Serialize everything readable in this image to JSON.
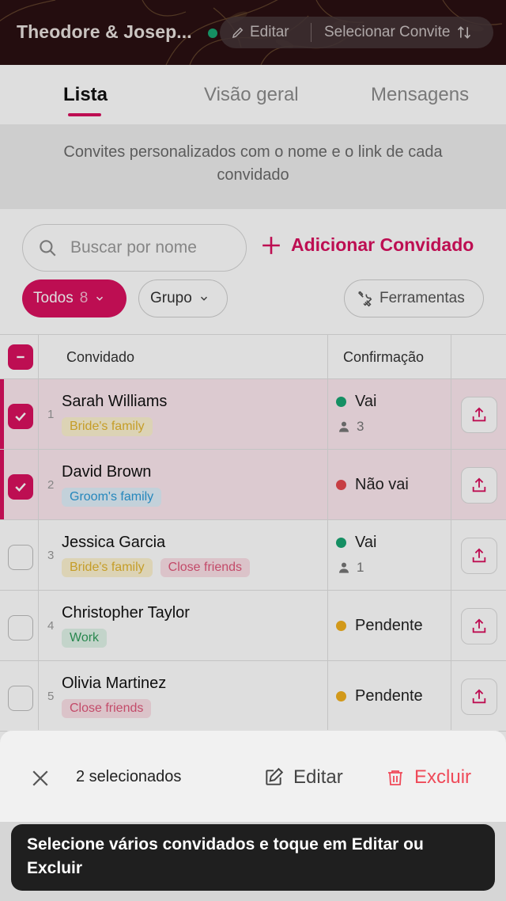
{
  "header": {
    "title": "Theodore & Josep...",
    "edit_label": "Editar",
    "select_label": "Selecionar Convite"
  },
  "tabs": [
    {
      "label": "Lista",
      "active": true
    },
    {
      "label": "Visão geral",
      "active": false
    },
    {
      "label": "Mensagens",
      "active": false
    }
  ],
  "banner": "Convites personalizados com o nome e o link de cada convidado",
  "search": {
    "placeholder": "Buscar por nome"
  },
  "add_guest_label": "Adicionar Convidado",
  "filters": {
    "todos_label": "Todos",
    "todos_count": "8",
    "grupo_label": "Grupo",
    "tools_label": "Ferramentas"
  },
  "table": {
    "headers": {
      "guest": "Convidado",
      "confirmation": "Confirmação"
    },
    "rows": [
      {
        "index": "1",
        "name": "Sarah Williams",
        "tags": [
          "Bride's family"
        ],
        "status": "Vai",
        "status_color": "#19a572",
        "people": "3",
        "selected": true
      },
      {
        "index": "2",
        "name": "David Brown",
        "tags": [
          "Groom's family"
        ],
        "status": "Não vai",
        "status_color": "#e5484d",
        "people": "",
        "selected": true
      },
      {
        "index": "3",
        "name": "Jessica Garcia",
        "tags": [
          "Bride's family",
          "Close friends"
        ],
        "status": "Vai",
        "status_color": "#19a572",
        "people": "1",
        "selected": false
      },
      {
        "index": "4",
        "name": "Christopher Taylor",
        "tags": [
          "Work"
        ],
        "status": "Pendente",
        "status_color": "#f2b01e",
        "people": "",
        "selected": false
      },
      {
        "index": "5",
        "name": "Olivia Martinez",
        "tags": [
          "Close friends"
        ],
        "status": "Pendente",
        "status_color": "#f2b01e",
        "people": "",
        "selected": false
      }
    ]
  },
  "action_bar": {
    "selected_text": "2 selecionados",
    "edit_label": "Editar",
    "delete_label": "Excluir"
  },
  "toast": "Selecione vários convidados e toque em Editar ou Excluir",
  "colors": {
    "accent": "#d9115f",
    "header_bg": "#2a0f12",
    "delete": "#ef4a59"
  }
}
